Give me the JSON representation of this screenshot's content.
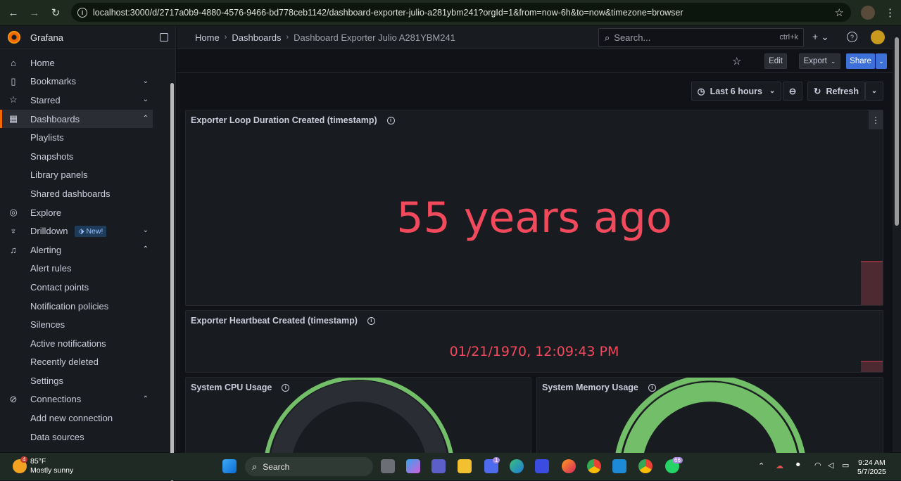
{
  "browser": {
    "url": "localhost:3000/d/2717a0b9-4880-4576-9466-bd778ceb1142/dashboard-exporter-julio-a281ybm241?orgId=1&from=now-6h&to=now&timezone=browser"
  },
  "sidebar": {
    "brand": "Grafana",
    "items": [
      {
        "label": "Home",
        "icon": "home-icon"
      },
      {
        "label": "Bookmarks",
        "icon": "bookmark-icon"
      },
      {
        "label": "Starred",
        "icon": "star-icon"
      },
      {
        "label": "Dashboards",
        "icon": "dashboards-icon"
      },
      {
        "label": "Playlists"
      },
      {
        "label": "Snapshots"
      },
      {
        "label": "Library panels"
      },
      {
        "label": "Shared dashboards"
      },
      {
        "label": "Explore",
        "icon": "compass-icon"
      },
      {
        "label": "Drilldown",
        "icon": "drilldown-icon",
        "badge": "New!"
      },
      {
        "label": "Alerting",
        "icon": "bell-icon"
      },
      {
        "label": "Alert rules"
      },
      {
        "label": "Contact points"
      },
      {
        "label": "Notification policies"
      },
      {
        "label": "Silences"
      },
      {
        "label": "Active notifications"
      },
      {
        "label": "Recently deleted"
      },
      {
        "label": "Settings"
      },
      {
        "label": "Connections",
        "icon": "connections-icon"
      },
      {
        "label": "Add new connection"
      },
      {
        "label": "Data sources"
      }
    ]
  },
  "topbar": {
    "breadcrumb": [
      "Home",
      "Dashboards",
      "Dashboard Exporter Julio A281YBM241"
    ],
    "search_placeholder": "Search...",
    "search_shortcut": "ctrl+k"
  },
  "actions": {
    "edit": "Edit",
    "export": "Export",
    "share": "Share"
  },
  "timepicker": {
    "range": "Last 6 hours",
    "refresh": "Refresh"
  },
  "panels": {
    "loop_duration": {
      "title": "Exporter Loop Duration Created (timestamp)",
      "value": "55 years ago"
    },
    "heartbeat": {
      "title": "Exporter Heartbeat Created (timestamp)",
      "value": "01/21/1970, 12:09:43 PM"
    },
    "cpu": {
      "title": "System CPU Usage"
    },
    "memory": {
      "title": "System Memory Usage"
    }
  },
  "colors": {
    "value_red": "#f2495c",
    "gauge_green": "#73bf69",
    "brand_orange": "#f46800",
    "share_blue": "#3d71d9"
  },
  "taskbar": {
    "weather_temp": "85°F",
    "weather_desc": "Mostly sunny",
    "weather_badge": "4",
    "search_label": "Search",
    "time": "9:24 AM",
    "date": "5/7/2025",
    "notif_badge_1": "1",
    "notif_badge_2": "66"
  }
}
